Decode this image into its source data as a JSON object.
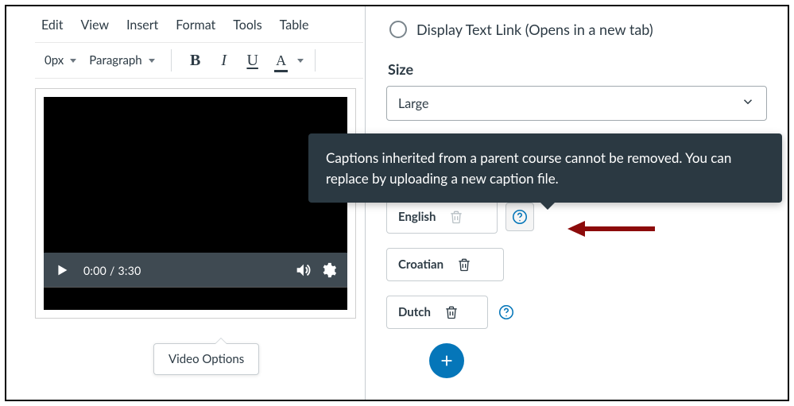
{
  "editor": {
    "menu": {
      "edit": "Edit",
      "view": "View",
      "insert": "Insert",
      "format": "Format",
      "tools": "Tools",
      "table": "Table"
    },
    "toolbar": {
      "font_size": "0px",
      "block_format": "Paragraph"
    },
    "video": {
      "current_time": "0:00",
      "duration": "3:30"
    },
    "video_options_popover": "Video Options"
  },
  "panel": {
    "display_text_link_label": "Display Text Link (Opens in a new tab)",
    "size_label": "Size",
    "size_value": "Large",
    "tooltip_text": "Captions inherited from a parent course cannot be removed. You can replace by uploading a new caption file.",
    "captions": [
      {
        "language": "English",
        "removable": false,
        "has_help": true
      },
      {
        "language": "Croatian",
        "removable": true,
        "has_help": false
      },
      {
        "language": "Dutch",
        "removable": true,
        "has_help": true
      }
    ]
  }
}
